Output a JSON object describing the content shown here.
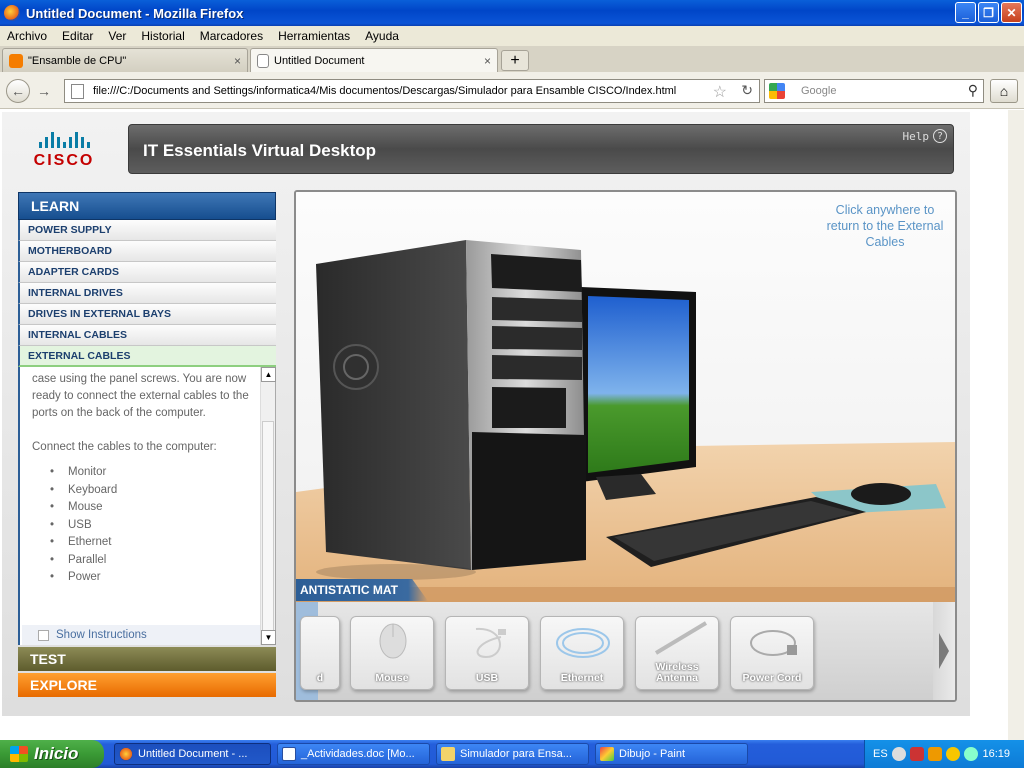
{
  "window": {
    "title": "Untitled Document - Mozilla Firefox"
  },
  "menu": [
    "Archivo",
    "Editar",
    "Ver",
    "Historial",
    "Marcadores",
    "Herramientas",
    "Ayuda"
  ],
  "tabs": [
    {
      "label": "\"Ensamble de CPU\"",
      "active": false
    },
    {
      "label": "Untitled Document",
      "active": true
    }
  ],
  "navbar": {
    "url": "file:///C:/Documents and Settings/informatica4/Mis documentos/Descargas/Simulador para Ensamble CISCO/Index.html",
    "search_placeholder": "Google"
  },
  "app": {
    "brand": "CISCO",
    "title": "IT Essentials Virtual Desktop",
    "help": "Help",
    "learn_label": "LEARN",
    "learn_items": [
      "POWER SUPPLY",
      "MOTHERBOARD",
      "ADAPTER CARDS",
      "INTERNAL DRIVES",
      "DRIVES IN EXTERNAL BAYS",
      "INTERNAL CABLES",
      "EXTERNAL CABLES"
    ],
    "active_item": "EXTERNAL CABLES",
    "instructions": {
      "paragraph": "case using the panel screws. You are now ready to connect the external cables to the ports on the back of the computer.",
      "prompt": "Connect the cables to the computer:",
      "cables": [
        "Monitor",
        "Keyboard",
        "Mouse",
        "USB",
        "Ethernet",
        "Parallel",
        "Power"
      ],
      "show_label": "Show Instructions"
    },
    "test_label": "TEST",
    "explore_label": "EXPLORE",
    "click_hint": "Click anywhere to return to the External Cables",
    "mat_label": "ANTISTATIC MAT",
    "tray_items": [
      "d",
      "Mouse",
      "USB",
      "Ethernet",
      "Wireless Antenna",
      "Power Cord"
    ]
  },
  "taskbar": {
    "start": "Inicio",
    "items": [
      "Untitled Document - ...",
      "_Actividades.doc [Mo...",
      "Simulador para Ensa...",
      "Dibujo - Paint"
    ],
    "lang": "ES",
    "clock": "16:19"
  },
  "colors": {
    "learn_blue": "#164e8f",
    "test_olive": "#5e5c2d",
    "explore_orange": "#e86a00",
    "hint_blue": "#5a94c6"
  }
}
